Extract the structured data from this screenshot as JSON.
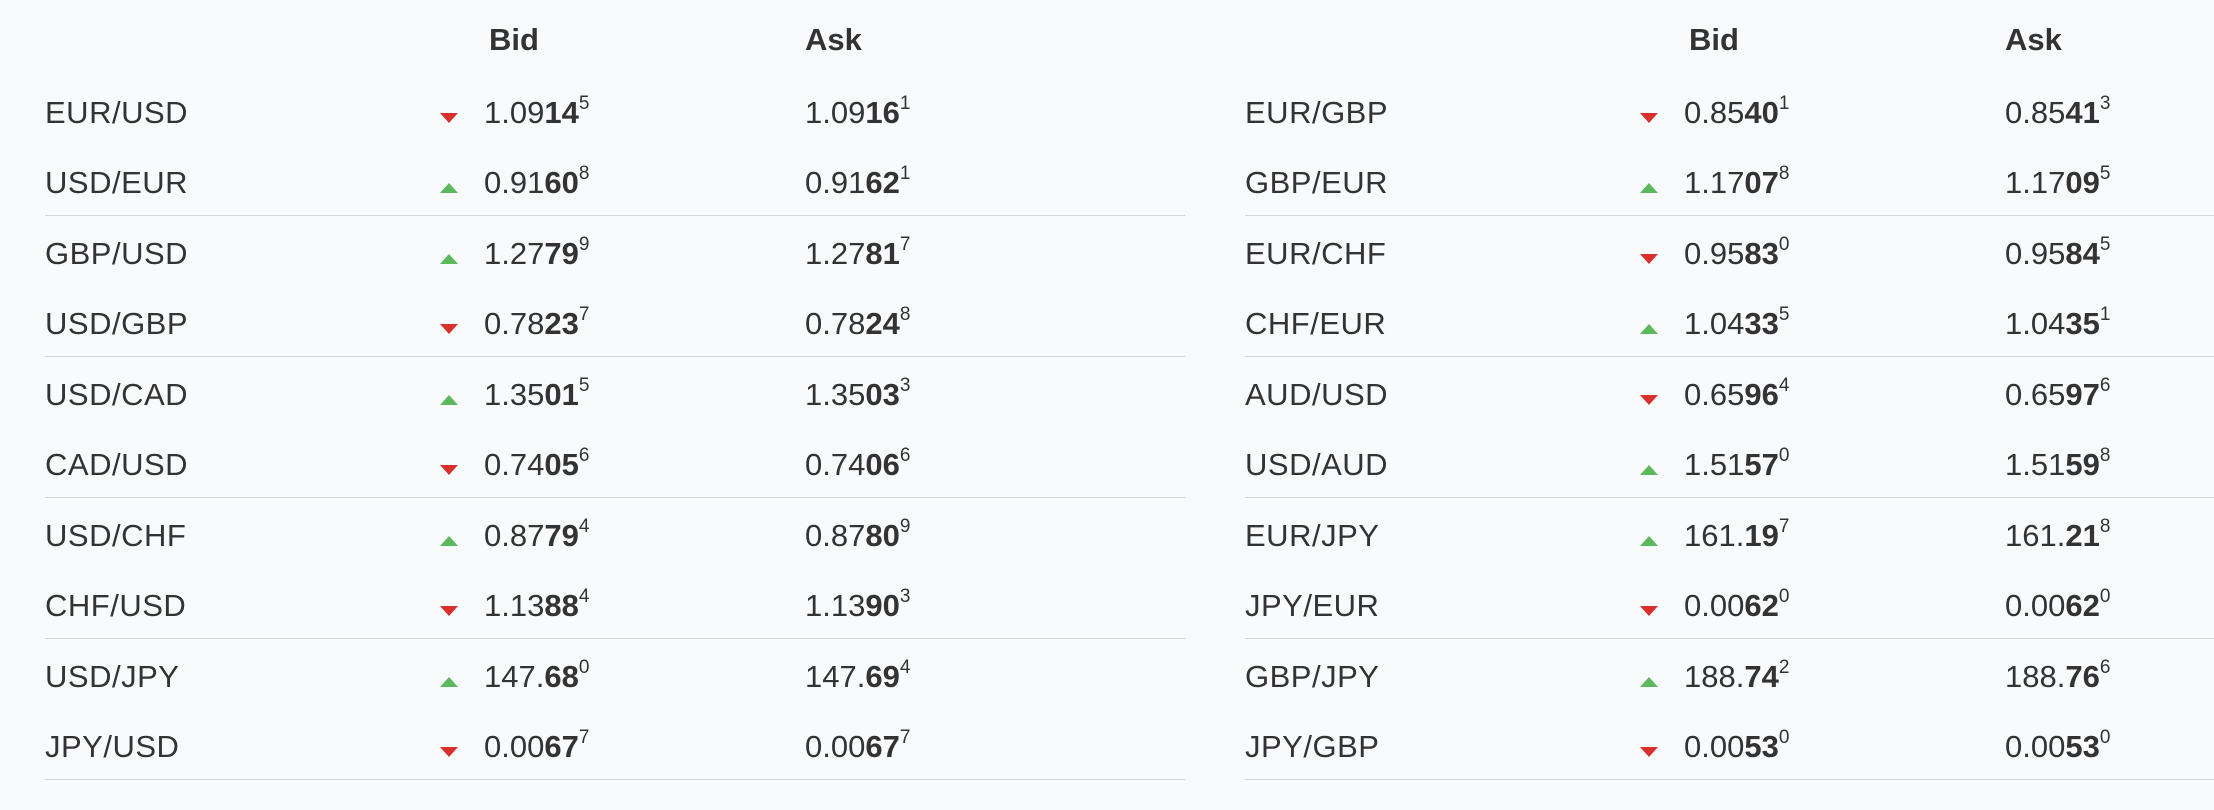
{
  "tables": [
    {
      "bid_header": "Bid",
      "ask_header": "Ask",
      "rows": [
        {
          "pair": "EUR/USD",
          "dir": "down",
          "bid": [
            "1.09",
            "14",
            "5"
          ],
          "ask": [
            "1.09",
            "16",
            "1"
          ]
        },
        {
          "pair": "USD/EUR",
          "dir": "up",
          "bid": [
            "0.91",
            "60",
            "8"
          ],
          "ask": [
            "0.91",
            "62",
            "1"
          ]
        },
        {
          "pair": "GBP/USD",
          "dir": "up",
          "bid": [
            "1.27",
            "79",
            "9"
          ],
          "ask": [
            "1.27",
            "81",
            "7"
          ]
        },
        {
          "pair": "USD/GBP",
          "dir": "down",
          "bid": [
            "0.78",
            "23",
            "7"
          ],
          "ask": [
            "0.78",
            "24",
            "8"
          ]
        },
        {
          "pair": "USD/CAD",
          "dir": "up",
          "bid": [
            "1.35",
            "01",
            "5"
          ],
          "ask": [
            "1.35",
            "03",
            "3"
          ]
        },
        {
          "pair": "CAD/USD",
          "dir": "down",
          "bid": [
            "0.74",
            "05",
            "6"
          ],
          "ask": [
            "0.74",
            "06",
            "6"
          ]
        },
        {
          "pair": "USD/CHF",
          "dir": "up",
          "bid": [
            "0.87",
            "79",
            "4"
          ],
          "ask": [
            "0.87",
            "80",
            "9"
          ]
        },
        {
          "pair": "CHF/USD",
          "dir": "down",
          "bid": [
            "1.13",
            "88",
            "4"
          ],
          "ask": [
            "1.13",
            "90",
            "3"
          ]
        },
        {
          "pair": "USD/JPY",
          "dir": "up",
          "bid": [
            "147.",
            "68",
            "0"
          ],
          "ask": [
            "147.",
            "69",
            "4"
          ]
        },
        {
          "pair": "JPY/USD",
          "dir": "down",
          "bid": [
            "0.00",
            "67",
            "7"
          ],
          "ask": [
            "0.00",
            "67",
            "7"
          ]
        }
      ]
    },
    {
      "bid_header": "Bid",
      "ask_header": "Ask",
      "rows": [
        {
          "pair": "EUR/GBP",
          "dir": "down",
          "bid": [
            "0.85",
            "40",
            "1"
          ],
          "ask": [
            "0.85",
            "41",
            "3"
          ]
        },
        {
          "pair": "GBP/EUR",
          "dir": "up",
          "bid": [
            "1.17",
            "07",
            "8"
          ],
          "ask": [
            "1.17",
            "09",
            "5"
          ]
        },
        {
          "pair": "EUR/CHF",
          "dir": "down",
          "bid": [
            "0.95",
            "83",
            "0"
          ],
          "ask": [
            "0.95",
            "84",
            "5"
          ]
        },
        {
          "pair": "CHF/EUR",
          "dir": "up",
          "bid": [
            "1.04",
            "33",
            "5"
          ],
          "ask": [
            "1.04",
            "35",
            "1"
          ]
        },
        {
          "pair": "AUD/USD",
          "dir": "down",
          "bid": [
            "0.65",
            "96",
            "4"
          ],
          "ask": [
            "0.65",
            "97",
            "6"
          ]
        },
        {
          "pair": "USD/AUD",
          "dir": "up",
          "bid": [
            "1.51",
            "57",
            "0"
          ],
          "ask": [
            "1.51",
            "59",
            "8"
          ]
        },
        {
          "pair": "EUR/JPY",
          "dir": "up",
          "bid": [
            "161.",
            "19",
            "7"
          ],
          "ask": [
            "161.",
            "21",
            "8"
          ]
        },
        {
          "pair": "JPY/EUR",
          "dir": "down",
          "bid": [
            "0.00",
            "62",
            "0"
          ],
          "ask": [
            "0.00",
            "62",
            "0"
          ]
        },
        {
          "pair": "GBP/JPY",
          "dir": "up",
          "bid": [
            "188.",
            "74",
            "2"
          ],
          "ask": [
            "188.",
            "76",
            "6"
          ]
        },
        {
          "pair": "JPY/GBP",
          "dir": "down",
          "bid": [
            "0.00",
            "53",
            "0"
          ],
          "ask": [
            "0.00",
            "53",
            "0"
          ]
        }
      ]
    }
  ],
  "colors": {
    "up_arrow": "#5cb85c",
    "down_arrow": "#d9302c",
    "text": "#333333",
    "divider": "#d6d6d6",
    "background": "#f9fafc"
  },
  "icons": {
    "up": "arrow-up-icon",
    "down": "arrow-down-icon"
  }
}
